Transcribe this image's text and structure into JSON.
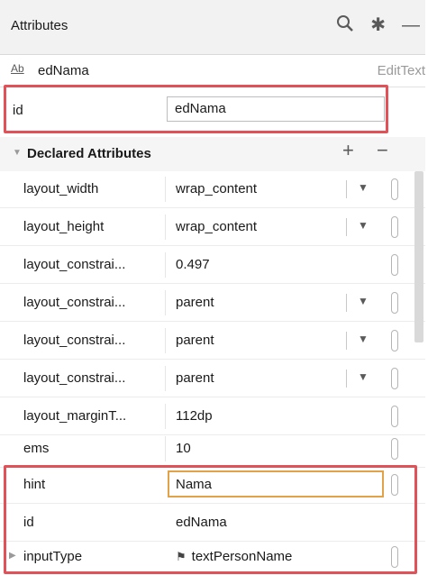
{
  "header": {
    "title": "Attributes"
  },
  "icons": {
    "search": "search-icon",
    "settings": "gear-icon",
    "minimize": "minus-icon"
  },
  "component": {
    "icon_text": "Ab",
    "name": "edNama",
    "type": "EditText"
  },
  "id_field": {
    "label": "id",
    "value": "edNama"
  },
  "section": {
    "title": "Declared Attributes",
    "add": "+",
    "remove": "−"
  },
  "rows": [
    {
      "label": "layout_width",
      "value": "wrap_content",
      "has_dropdown": true
    },
    {
      "label": "layout_height",
      "value": "wrap_content",
      "has_dropdown": true
    },
    {
      "label": "layout_constrai...",
      "value": "0.497",
      "has_dropdown": false
    },
    {
      "label": "layout_constrai...",
      "value": "parent",
      "has_dropdown": true
    },
    {
      "label": "layout_constrai...",
      "value": "parent",
      "has_dropdown": true
    },
    {
      "label": "layout_constrai...",
      "value": "parent",
      "has_dropdown": true
    },
    {
      "label": "layout_marginT...",
      "value": "112dp",
      "has_dropdown": false
    },
    {
      "label": "ems",
      "value": "10",
      "has_dropdown": false
    },
    {
      "label": "hint",
      "value": "Nama",
      "has_dropdown": false
    },
    {
      "label": "id",
      "value": "edNama",
      "has_dropdown": false
    },
    {
      "label": "inputType",
      "value": "textPersonName",
      "has_dropdown": false
    }
  ],
  "colors": {
    "highlight": "#e05258",
    "focus": "#e2a24a"
  }
}
